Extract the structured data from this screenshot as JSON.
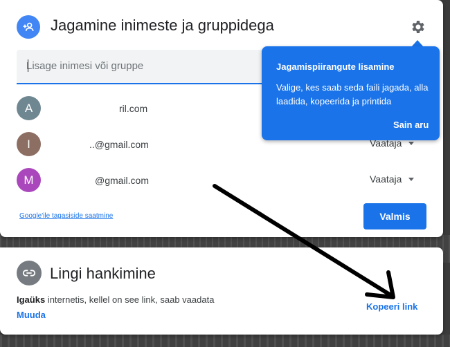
{
  "share": {
    "title": "Jagamine inimeste ja gruppidega",
    "header_icon": "person-add-icon",
    "settings_icon": "gear-icon",
    "input_placeholder": "Lisage inimesi või gruppe",
    "people": [
      {
        "initial": "A",
        "color": "#6f8791",
        "email": "ril.com",
        "role": ""
      },
      {
        "initial": "I",
        "color": "#8d6e63",
        "email": "..@gmail.com",
        "role": "Vaataja"
      },
      {
        "initial": "M",
        "color": "#ab47bc",
        "email": "@gmail.com",
        "role": "Vaataja"
      }
    ],
    "feedback_link": "Google'ile tagasiside saatmine",
    "done_button": "Valmis"
  },
  "tooltip": {
    "title": "Jagamispiirangute lisamine",
    "body": "Valige, kes saab seda faili jagada, alla laadida, kopeerida ja printida",
    "button": "Sain aru"
  },
  "link": {
    "title": "Lingi hankimine",
    "icon": "link-icon",
    "desc_bold": "Igaüks",
    "desc_rest": " internetis, kellel on see link, saab vaadata",
    "change_link": "Muuda",
    "copy_link": "Kopeeri link"
  },
  "colors": {
    "accent": "#1a73e8",
    "annotation_arrow": "#000000"
  }
}
